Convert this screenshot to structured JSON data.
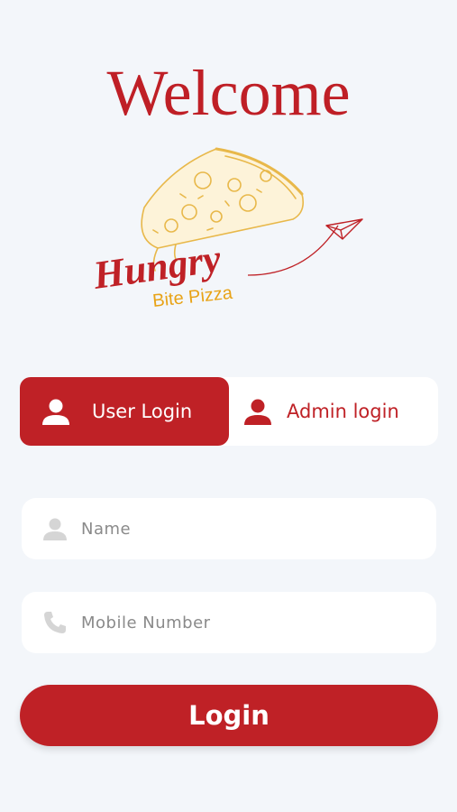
{
  "header": {
    "title": "Welcome"
  },
  "logo": {
    "word1": "Hungry",
    "word2": "Bite Pizza"
  },
  "tabs": [
    {
      "label": "User Login",
      "icon": "person-icon",
      "active": true
    },
    {
      "label": "Admin login",
      "icon": "person-icon",
      "active": false
    }
  ],
  "form": {
    "name": {
      "placeholder": "Name",
      "value": "",
      "icon": "person-icon"
    },
    "mobile": {
      "placeholder": "Mobile Number",
      "value": "",
      "icon": "phone-icon"
    }
  },
  "login_button": {
    "label": "Login"
  },
  "colors": {
    "brand": "#bf2126",
    "accent": "#e8a317",
    "background": "#f3f6fa"
  }
}
